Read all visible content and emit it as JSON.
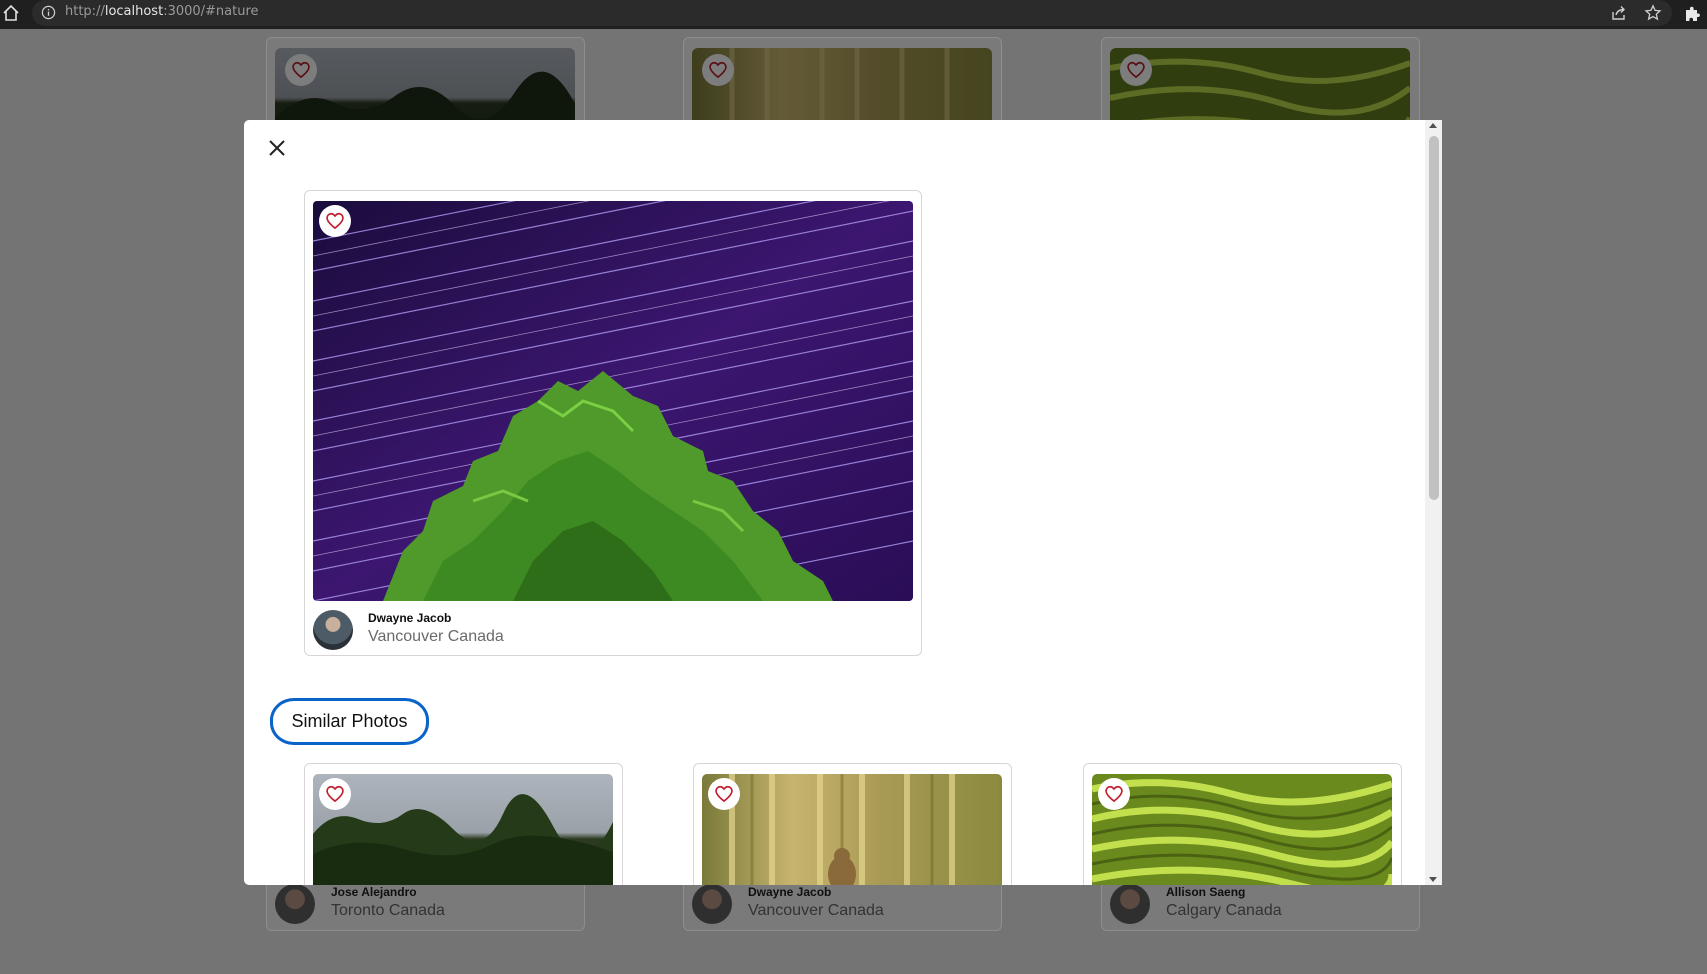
{
  "browser": {
    "url_scheme": "http://",
    "url_host": "localhost",
    "url_rest": ":3000/#nature"
  },
  "background_gallery": [
    {
      "author": "Jose Alejandro",
      "location": "Toronto Canada"
    },
    {
      "author": "Dwayne Jacob",
      "location": "Vancouver Canada"
    },
    {
      "author": "Allison Saeng",
      "location": "Calgary Canada"
    }
  ],
  "modal": {
    "photo": {
      "author": "Dwayne Jacob",
      "location": "Vancouver Canada"
    },
    "similar_heading": "Similar Photos",
    "similar": [
      {
        "author": "Jose Alejandro",
        "location": "Toronto Canada"
      },
      {
        "author": "Dwayne Jacob",
        "location": "Vancouver Canada"
      },
      {
        "author": "Allison Saeng",
        "location": "Calgary Canada"
      }
    ]
  },
  "colors": {
    "heart": "#c0202f",
    "highlight": "#0a63c9",
    "overlay": "#747474"
  }
}
